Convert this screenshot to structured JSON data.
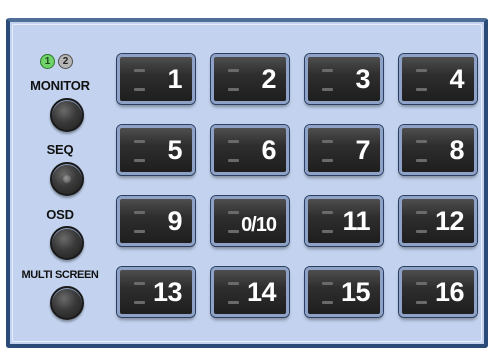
{
  "monitor_indicators": [
    {
      "label": "1",
      "state": "on",
      "color": "#6fd36a"
    },
    {
      "label": "2",
      "state": "off",
      "color": "#b5b5b5"
    }
  ],
  "side_controls": [
    {
      "label": "MONITOR"
    },
    {
      "label": "SEQ"
    },
    {
      "label": "OSD"
    },
    {
      "label": "MULTI SCREEN"
    }
  ],
  "keypad": [
    {
      "label": "1"
    },
    {
      "label": "2"
    },
    {
      "label": "3"
    },
    {
      "label": "4"
    },
    {
      "label": "5"
    },
    {
      "label": "6"
    },
    {
      "label": "7"
    },
    {
      "label": "8"
    },
    {
      "label": "9"
    },
    {
      "label": "0/10"
    },
    {
      "label": "11"
    },
    {
      "label": "12"
    },
    {
      "label": "13"
    },
    {
      "label": "14"
    },
    {
      "label": "15"
    },
    {
      "label": "16"
    }
  ],
  "colors": {
    "panel_bg": "#c3d3ef",
    "panel_border": "#2a4a78",
    "key_face": "#2e2e2e",
    "key_text": "#ffffff"
  }
}
